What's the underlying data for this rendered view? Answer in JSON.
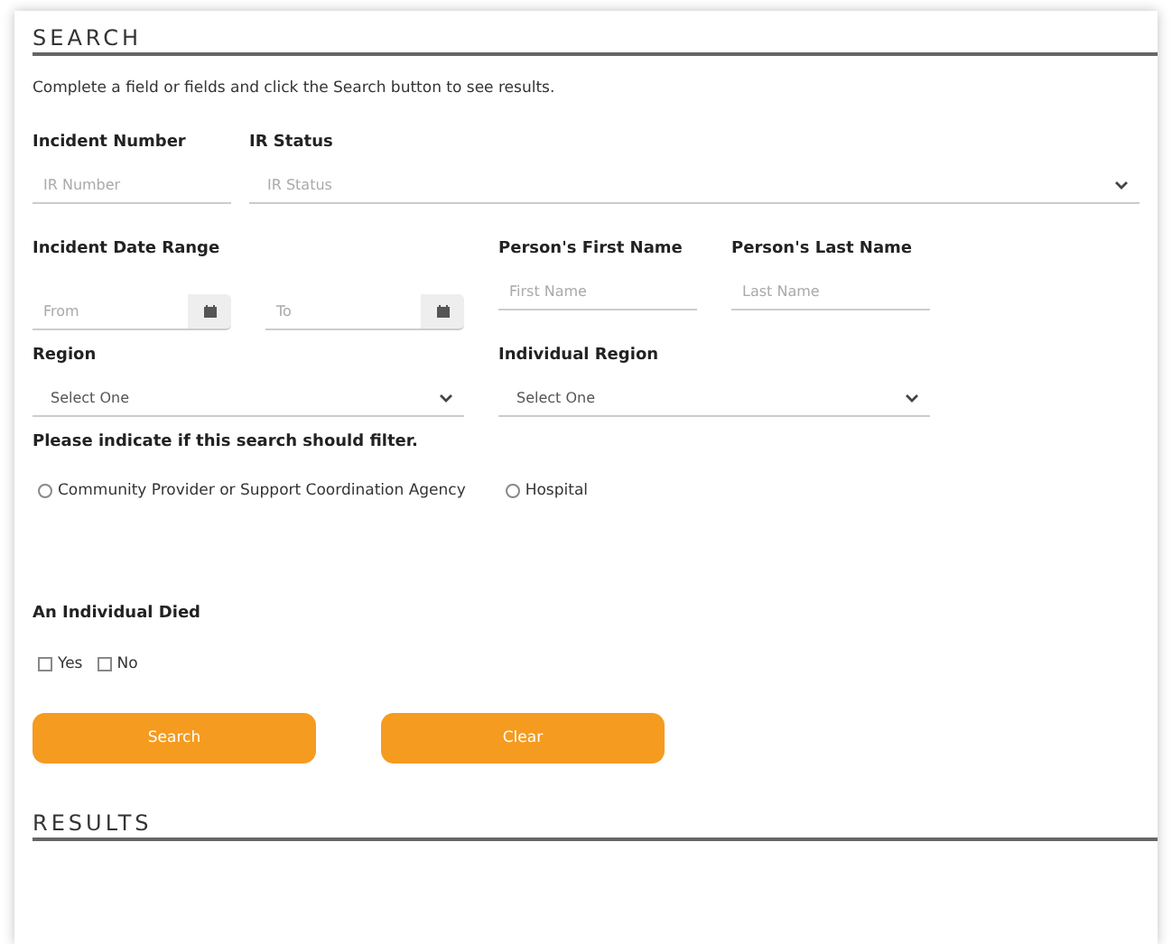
{
  "search_title": "SEARCH",
  "instructions": "Complete a field or fields and click the Search button to see results.",
  "incident_number": {
    "label": "Incident Number",
    "placeholder": "IR Number"
  },
  "ir_status": {
    "label": "IR Status",
    "placeholder": "IR Status"
  },
  "date_range": {
    "label": "Incident Date Range",
    "from_placeholder": "From",
    "to_placeholder": "To"
  },
  "first_name": {
    "label": "Person's First Name",
    "placeholder": "First Name"
  },
  "last_name": {
    "label": "Person's Last Name",
    "placeholder": "Last Name"
  },
  "region": {
    "label": "Region",
    "value": "Select One"
  },
  "individual_region": {
    "label": "Individual Region",
    "value": "Select One"
  },
  "filter": {
    "label": "Please indicate if this search should filter.",
    "options": [
      {
        "label": "Community Provider or Support Coordination Agency",
        "selected": false
      },
      {
        "label": "Hospital",
        "selected": false
      }
    ]
  },
  "individual_died": {
    "label": "An Individual Died",
    "options": [
      {
        "label": "Yes",
        "checked": false
      },
      {
        "label": "No",
        "checked": false
      }
    ]
  },
  "buttons": [
    "Search",
    "Clear"
  ],
  "results_title": "RESULTS"
}
